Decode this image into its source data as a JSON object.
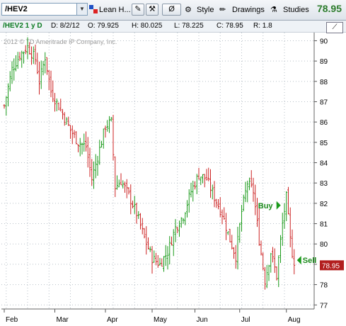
{
  "toolbar": {
    "symbol": "/HEV2",
    "study_set": "Lean H...",
    "style_label": "Style",
    "drawings_label": "Drawings",
    "studies_label": "Studies",
    "last_price": "78.95",
    "price_color": "#2b7b2b"
  },
  "info": {
    "symbol_period": "/HEV2 1 y D",
    "date": "D: 8/2/12",
    "open": "O: 79.925",
    "high": "H: 80.025",
    "low": "L: 78.225",
    "close": "C: 78.95",
    "range": "R: 1.8"
  },
  "copyright": "2012 © TD Ameritrade IP Company, Inc.",
  "chart_data": {
    "type": "bar",
    "style": "ohlc",
    "up_color": "#1a9a1a",
    "down_color": "#cc2222",
    "y_ticks": [
      77,
      78,
      79,
      80,
      81,
      82,
      83,
      84,
      85,
      86,
      87,
      88,
      89,
      90
    ],
    "ylim": [
      76.8,
      90.4
    ],
    "x_ticks": [
      "Feb",
      "Mar",
      "Apr",
      "May",
      "Jun",
      "Jul",
      "Aug"
    ],
    "grid": true,
    "current_price_label": "78.95",
    "current_price": 78.95,
    "signals": [
      {
        "label": "Buy",
        "price": 81.9,
        "near": "late Jul"
      },
      {
        "label": "Sell",
        "price": 79.2,
        "near": "early Aug"
      }
    ],
    "anchors": [
      {
        "i": 0,
        "p": 86.8
      },
      {
        "i": 4,
        "p": 88.6
      },
      {
        "i": 8,
        "p": 89.3
      },
      {
        "i": 12,
        "p": 89.7
      },
      {
        "i": 16,
        "p": 89.1
      },
      {
        "i": 18,
        "p": 88.0
      },
      {
        "i": 21,
        "p": 89.2
      },
      {
        "i": 24,
        "p": 87.5
      },
      {
        "i": 30,
        "p": 86.4
      },
      {
        "i": 34,
        "p": 85.6
      },
      {
        "i": 38,
        "p": 85.0
      },
      {
        "i": 42,
        "p": 84.8
      },
      {
        "i": 45,
        "p": 83.2
      },
      {
        "i": 48,
        "p": 84.3
      },
      {
        "i": 52,
        "p": 85.8
      },
      {
        "i": 55,
        "p": 86.0
      },
      {
        "i": 57,
        "p": 82.8
      },
      {
        "i": 60,
        "p": 83.1
      },
      {
        "i": 64,
        "p": 82.4
      },
      {
        "i": 68,
        "p": 81.5
      },
      {
        "i": 72,
        "p": 80.3
      },
      {
        "i": 76,
        "p": 79.3
      },
      {
        "i": 80,
        "p": 79.0
      },
      {
        "i": 84,
        "p": 79.6
      },
      {
        "i": 88,
        "p": 80.8
      },
      {
        "i": 92,
        "p": 81.4
      },
      {
        "i": 96,
        "p": 82.6
      },
      {
        "i": 100,
        "p": 83.4
      },
      {
        "i": 104,
        "p": 83.2
      },
      {
        "i": 108,
        "p": 82.3
      },
      {
        "i": 112,
        "p": 81.5
      },
      {
        "i": 116,
        "p": 80.2
      },
      {
        "i": 119,
        "p": 79.4
      },
      {
        "i": 122,
        "p": 81.6
      },
      {
        "i": 125,
        "p": 83.0
      },
      {
        "i": 128,
        "p": 82.6
      },
      {
        "i": 131,
        "p": 80.2
      },
      {
        "i": 134,
        "p": 78.2
      },
      {
        "i": 137,
        "p": 79.6
      },
      {
        "i": 140,
        "p": 78.4
      },
      {
        "i": 143,
        "p": 81.0
      },
      {
        "i": 145,
        "p": 82.3
      },
      {
        "i": 147,
        "p": 80.2
      },
      {
        "i": 149,
        "p": 78.95
      }
    ]
  }
}
